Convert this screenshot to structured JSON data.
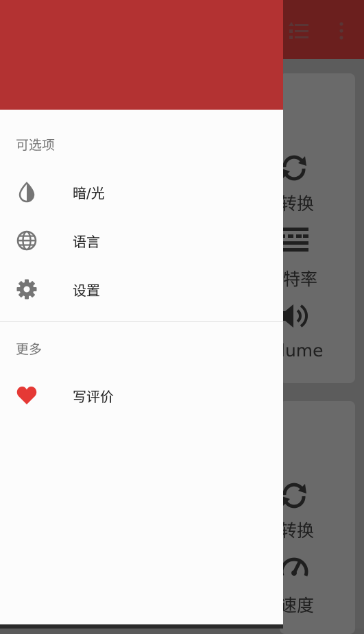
{
  "drawer": {
    "sections": [
      {
        "title": "可选项",
        "items": [
          {
            "label": "暗/光",
            "icon": "brightness-icon"
          },
          {
            "label": "语言",
            "icon": "globe-icon"
          },
          {
            "label": "设置",
            "icon": "gear-icon"
          }
        ]
      },
      {
        "title": "更多",
        "items": [
          {
            "label": "写评价",
            "icon": "heart-icon"
          }
        ]
      }
    ],
    "colors": {
      "header": "#b33232",
      "icon": "#757575",
      "heart": "#e53935"
    }
  },
  "background": {
    "card1": {
      "labels": [
        "转换",
        "特率",
        "lume"
      ]
    },
    "card2": {
      "labels": [
        "转换",
        "速度"
      ]
    }
  }
}
